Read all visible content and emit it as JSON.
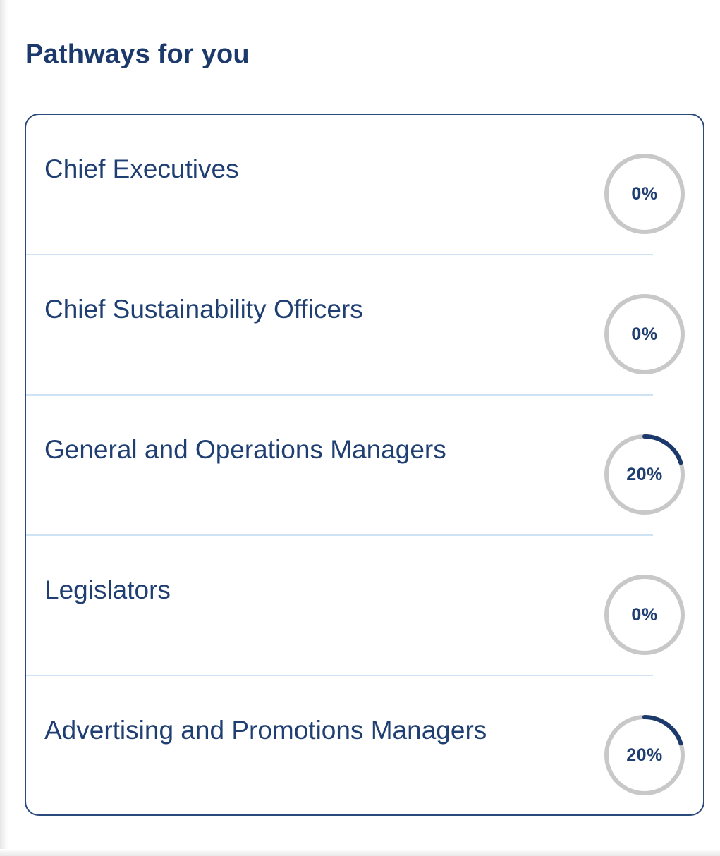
{
  "panel": {
    "title": "Pathways for you"
  },
  "pathways": [
    {
      "title": "Chief Executives",
      "progress_label": "0%",
      "progress": 0
    },
    {
      "title": "Chief Sustainability Officers",
      "progress_label": "0%",
      "progress": 0
    },
    {
      "title": "General and Operations Managers",
      "progress_label": "20%",
      "progress": 0.2
    },
    {
      "title": "Legislators",
      "progress_label": "0%",
      "progress": 0
    },
    {
      "title": "Advertising and Promotions Managers",
      "progress_label": "20%",
      "progress": 0.2
    }
  ],
  "colors": {
    "heading": "#1b3a6b",
    "text": "#1f3f73",
    "border": "#2a4a7c",
    "divider": "#cfe3f5",
    "ring_track": "#c8c8c8",
    "ring_fill": "#1b3a6b"
  }
}
